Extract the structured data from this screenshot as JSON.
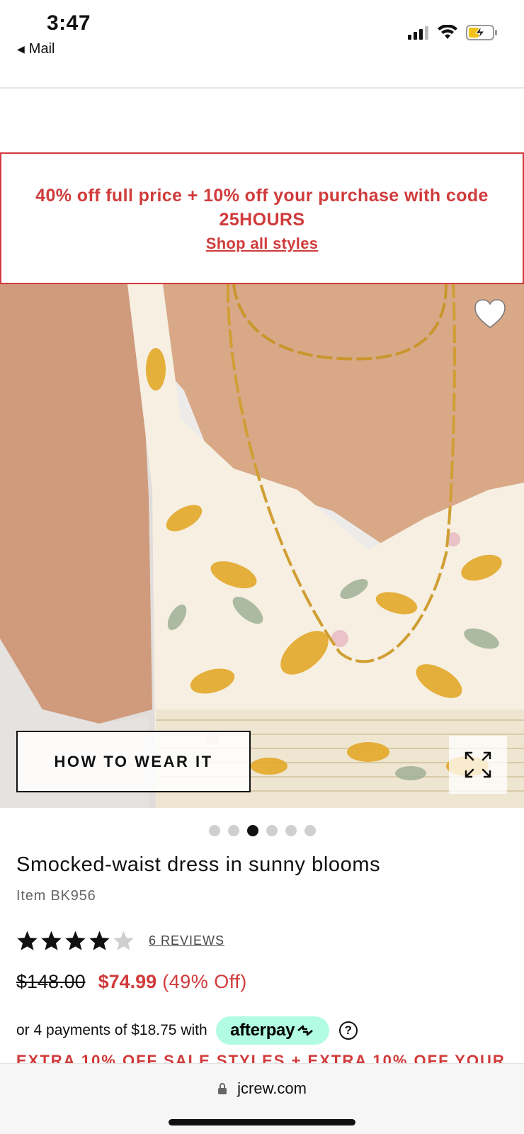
{
  "status_bar": {
    "time": "3:47",
    "back_app": "Mail",
    "icons": [
      "cellular-signal-icon",
      "wifi-icon",
      "battery-charging-icon"
    ]
  },
  "promo": {
    "text": "40% off full price + 10% off your purchase with code 25HOURS",
    "link": "Shop all styles",
    "color": "#d03b3b"
  },
  "hero": {
    "how_to_wear": "HOW TO WEAR IT",
    "carousel_total": 6,
    "carousel_active": 3
  },
  "product": {
    "title": "Smocked-waist dress in sunny blooms",
    "item": "Item BK956",
    "rating": 4,
    "rating_max": 5,
    "reviews": "6 REVIEWS",
    "original_price": "$148.00",
    "sale_price": "$74.99",
    "discount": "(49% Off)",
    "installments": "or 4 payments of $18.75 with",
    "afterpay": "afterpay",
    "afterpay_color": "#b2fce4",
    "help": "?",
    "extra_offer": "EXTRA 10% OFF SALE STYLES + EXTRA 10% OFF YOUR"
  },
  "browser": {
    "url": "jcrew.com"
  }
}
